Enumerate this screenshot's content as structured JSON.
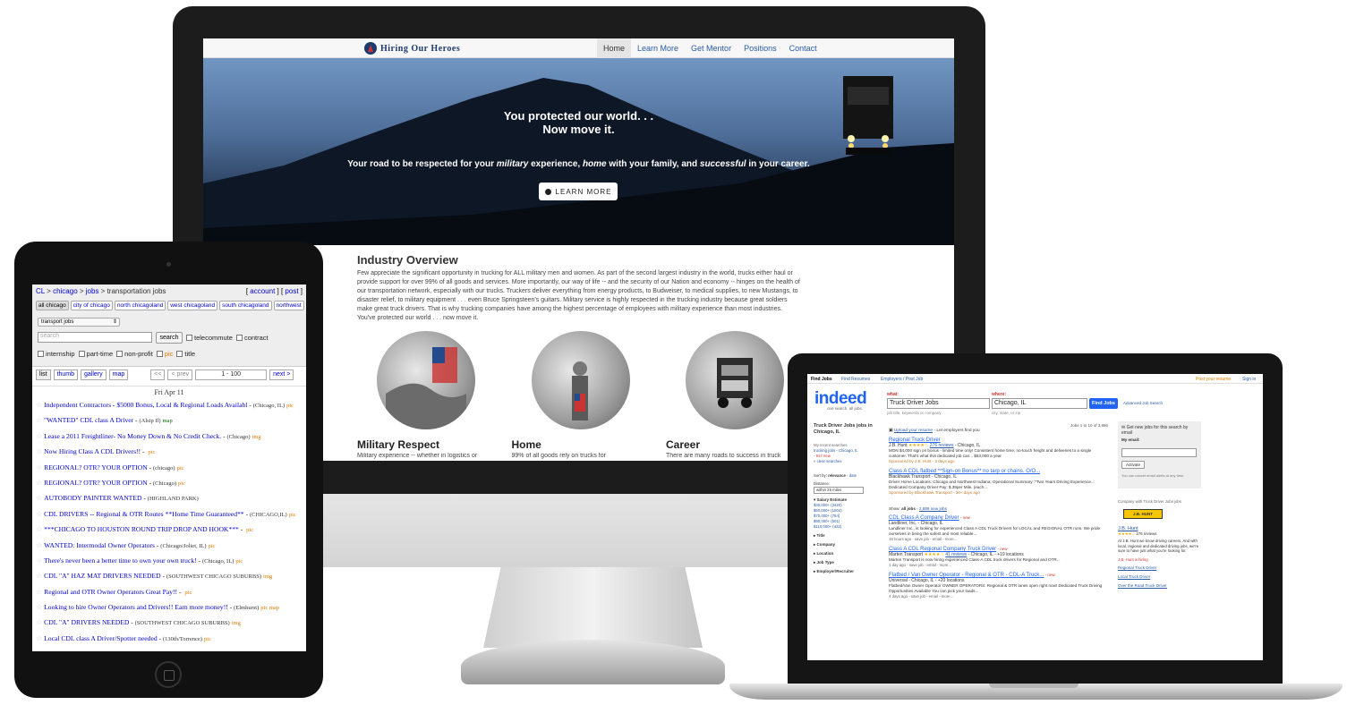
{
  "hoh": {
    "logo_text": "Hiring Our Heroes",
    "nav": [
      "Home",
      "Learn More",
      "Get Mentor",
      "Positions",
      "Contact"
    ],
    "hero_title_line1": "You protected our world. . .",
    "hero_title_line2": "Now move it.",
    "hero_sub_1": "Your road to be respected for your ",
    "hero_sub_military": "military",
    "hero_sub_2": " experience, ",
    "hero_sub_home": "home",
    "hero_sub_3": " with your family, and ",
    "hero_sub_successful": "successful",
    "hero_sub_4": " in your career.",
    "hero_button": "LEARN MORE",
    "overview_title": "Industry Overview",
    "overview_text": "Few appreciate the significant opportunity in trucking for ALL military men and women. As part of the second largest industry in the world, trucks either haul or provide support for over 99% of all goods and services. More importantly, our way of life -- and the security of our Nation and economy -- hinges on the health of our transportation network, especially with our trucks. Truckers deliver everything from energy products, to Budweiser, to medical supplies, to new Mustangs, to disaster relief, to military equipment . . . even Bruce Springsteen's guitars. Military service is highly respected in the trucking industry because great soldiers make great truck drivers. That is why trucking companies have among the highest percentage of employees with military experience than most industries. You've protected our world . . . now move it.",
    "columns": [
      {
        "title": "Military Respect",
        "text": "Military experience -- whether in logistics or"
      },
      {
        "title": "Home",
        "text": "99% of all goods rely on trucks for"
      },
      {
        "title": "Career",
        "text": "There are many roads to success in truck"
      }
    ]
  },
  "cl": {
    "crumb_cl": "CL",
    "crumb_chicago": "chicago",
    "crumb_jobs": "jobs",
    "crumb_section": "transportation jobs",
    "crumb_sep": " > ",
    "account": "account",
    "post": "post",
    "areas": [
      "all chicago",
      "city of chicago",
      "north chicagoland",
      "west chicagoland",
      "south chicagoland",
      "northwest"
    ],
    "category_select": "transport jobs",
    "search_placeholder": "search",
    "search_button": "search",
    "checks_row1": [
      "telecommute",
      "contract"
    ],
    "checks_row2": [
      "internship",
      "part-time",
      "non-profit"
    ],
    "pic_label": "pic",
    "title_label": "title",
    "views": [
      "list",
      "thumb",
      "gallery",
      "map"
    ],
    "pager_first": "<<",
    "pager_prev": "< prev",
    "pager_range": "1 - 100",
    "pager_next": "next >",
    "date": "Fri Apr 11",
    "listings": [
      {
        "title": "Independent Contractors - $5000 Bonus, Local & Regional Loads Availabl",
        "loc": "(Chicago, IL)",
        "tag": "pic"
      },
      {
        "title": "\"WANTED\" CDL class A Driver",
        "loc": "(Alsip Il)",
        "tag": "map"
      },
      {
        "title": "Lease a 2011 Freightliner- No Money Down & No Credit Check.",
        "loc": "(Chicago)",
        "tag": "img"
      },
      {
        "title": "Now Hiring Class A CDL Drivers!!",
        "loc": "",
        "tag": "pic"
      },
      {
        "title": "REGIONAL? OTR? YOUR OPTION",
        "loc": "(chicago)",
        "tag": "pic"
      },
      {
        "title": "REGIONAL? OTR? YOUR OPTION",
        "loc": "(Chicago)",
        "tag": "pic"
      },
      {
        "title": "AUTOBODY PAINTER WANTED",
        "loc": "(HIGHLAND PARK)",
        "tag": ""
      },
      {
        "title": "CDL DRIVERS -- Regional & OTR Routes **Home Time Guaranteed**",
        "loc": "(CHICAGO,IL)",
        "tag": "pic"
      },
      {
        "title": "***CHICAGO TO HOUSTON ROUND TRIP DROP AND HOOK***",
        "loc": "",
        "tag": "pic"
      },
      {
        "title": "WANTED: Intermodal Owner Operators",
        "loc": "(Chicago/Joliet, IL)",
        "tag": "pic"
      },
      {
        "title": "There's never been a better time to own your own truck!",
        "loc": "(Chicago, IL)",
        "tag": "pic"
      },
      {
        "title": "CDL \"A\" HAZ MAT DRIVERS NEEDED",
        "loc": "(SOUTHWEST CHICAGO SUBURBS)",
        "tag": "img"
      },
      {
        "title": "Regional and OTR Owner Operators Great Pay!!",
        "loc": "",
        "tag": "pic"
      },
      {
        "title": "Looking to hire Owner Operators and Drivers!! Earn more money!!",
        "loc": "(Elmhurst)",
        "tag": "pic map"
      },
      {
        "title": "CDL \"A\" DRIVERS NEEDED",
        "loc": "(SOUTHWEST CHICAGO SUBURBS)",
        "tag": "img"
      },
      {
        "title": "Local CDL class A Driver/Spotter needed",
        "loc": "(130th/Torrence)",
        "tag": "pic"
      }
    ]
  },
  "indeed": {
    "top_links": [
      "Find Jobs",
      "Find Resumes",
      "Employers / Post Job"
    ],
    "post_resume": "Post your resume",
    "sign_in": "Sign in",
    "logo": "indeed",
    "tagline": "one search. all jobs.",
    "what_label": "what:",
    "where_label": "where:",
    "what_value": "Truck Driver Jobs",
    "where_value": "Chicago, IL",
    "what_hint": "job title, keywords or company",
    "where_hint": "city, state, or zip",
    "find_button": "Find Jobs",
    "advanced": "Advanced Job Search",
    "left_title": "Truck Driver Jobs jobs in Chicago, IL",
    "recent_label": "My recent searches",
    "recent_link": "trucking jobs - Chicago, IL",
    "recent_new": "- 917 new",
    "clear": "» clear searches",
    "sort_label": "Sort by:",
    "sort_relevance": "relevance",
    "sort_date": "date",
    "distance_label": "Distance:",
    "distance_value": "within 25 miles",
    "salary_label": "▾ Salary Estimate",
    "salaries": [
      "$30,000+ (3420)",
      "$50,000+ (1604)",
      "$70,000+ (784)",
      "$90,000+ (501)",
      "$110,000+ (432)"
    ],
    "facets": [
      "▸ Title",
      "▸ Company",
      "▸ Location",
      "▸ Job Type",
      "▸ Employer/Recruiter"
    ],
    "count": "Jobs 1 to 10 of 3,886",
    "upload": "Upload your resume",
    "upload_tail": " - Let employers find you",
    "show_label": "Show:",
    "show_all": "all jobs",
    "show_new": "2,886 new jobs",
    "jobs": [
      {
        "title": "Regional Truck Driver",
        "company": "J.B. Hunt",
        "stars": "★★★★☆",
        "reviews": "276 reviews",
        "loc": "- Chicago, IL",
        "snippet": "MON $4,000 sign on bonus - limited time only! Consistent home time, no-touch freight and deliveries to a single customer. That's what this dedicated job can... $53,000 a year",
        "meta": "Sponsored by J.B. Hunt - 3 days ago",
        "new": ""
      },
      {
        "title": "Class A CDL flatbed **Sign-on Bonus** no tarp or chains. O/O...",
        "company": "Blackhawk Transport",
        "stars": "",
        "reviews": "",
        "loc": "- Chicago, IL",
        "snippet": "Driver Home Locations: Chicago and Northwest Indiana; Operational Summary :*Two Years Driving Experience... Dedicated Company Driver Pay: $.39per Mile. (each...",
        "meta": "Sponsored by Blackhawk Transport - 30+ days ago",
        "new": ""
      },
      {
        "title": "CDL Class A Company Driver",
        "company": "Landliner, Inc.",
        "stars": "",
        "reviews": "",
        "loc": "- Chicago, IL",
        "snippet": "Landliner Inc., is looking for experienced Class A CDL Truck Drivers for LOCAL and REGIONAL OTR runs. We pride ourselves in being the safest and most reliable...",
        "meta": "18 hours ago - save job - email - more...",
        "new": "- new"
      },
      {
        "title": "Class A CDL Regional Company Truck Driver",
        "company": "Marten Transport",
        "stars": "★★★★☆",
        "reviews": "41 reviews",
        "loc": "- Chicago, IL - +19 locations",
        "snippet": "Marten Transport is now hiring experienced Class-A CDL truck drivers for Regional and OTR...",
        "meta": "1 day ago - save job - email - more...",
        "new": "- new"
      },
      {
        "title": "Flatbed / Van Owner Operator - Regional & OTR - CDL-A Truck...",
        "company": "Universal",
        "stars": "",
        "reviews": "",
        "loc": "- Chicago, IL - +20 locations",
        "snippet": "Flatbed/Van Owner Operator OWNER OPERATORS: Regional & OTR lanes open right now! Dedicated Truck Driving Opportunities Available You can pick your loads...",
        "meta": "4 days ago - save job - email - more...",
        "new": "- new"
      }
    ],
    "alert_title": "Get new jobs for this search by email",
    "alert_email_label": "My email:",
    "alert_activate": "Activate",
    "alert_note": "You can cancel email alerts at any time.",
    "company_label": "Company with Truck Driver Jobs jobs",
    "company_logo_text": "J.B. HUNT",
    "company_name": "J.B. Hunt",
    "company_reviews": "276 reviews",
    "company_blurb": "At J.B. Hunt we know driving careers. And with local, regional and dedicated driving jobs, we're sure to have just what you're looking for.",
    "company_hiring": "J.B. Hunt is hiring",
    "company_links": [
      "Regional Truck Driver",
      "Local Truck Driver",
      "Over the Road Truck Driver"
    ]
  }
}
